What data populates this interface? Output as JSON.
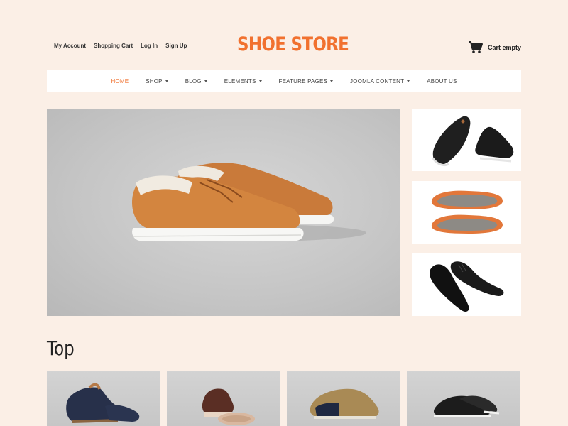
{
  "header": {
    "links": [
      "My Account",
      "Shopping Cart",
      "Log In",
      "Sign Up"
    ],
    "logo": "SHOE STORE",
    "cart_label": "Cart empty",
    "cart_icon": "shopping-cart-icon"
  },
  "nav": {
    "items": [
      {
        "label": "HOME",
        "dropdown": false,
        "active": true
      },
      {
        "label": "SHOP",
        "dropdown": true,
        "active": false
      },
      {
        "label": "BLOG",
        "dropdown": true,
        "active": false
      },
      {
        "label": "ELEMENTS",
        "dropdown": true,
        "active": false
      },
      {
        "label": "FEATURE PAGES",
        "dropdown": true,
        "active": false
      },
      {
        "label": "JOOMLA CONTENT",
        "dropdown": true,
        "active": false
      },
      {
        "label": "ABOUT US",
        "dropdown": false,
        "active": false
      }
    ]
  },
  "section": {
    "title": "Top"
  },
  "colors": {
    "accent": "#f1712f",
    "background": "#fbefe6",
    "nav_background": "#ffffff"
  }
}
